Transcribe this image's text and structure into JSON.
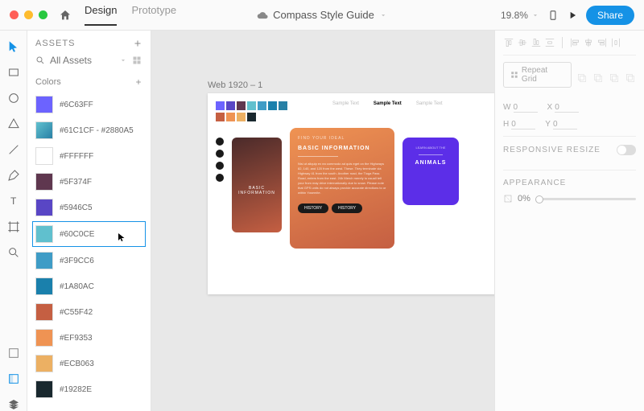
{
  "titlebar": {
    "tabs": {
      "design": "Design",
      "prototype": "Prototype"
    },
    "doc_name": "Compass Style Guide",
    "zoom": "19.8%",
    "share": "Share"
  },
  "assets": {
    "header": "ASSETS",
    "search_placeholder": "All Assets",
    "section_colors": "Colors",
    "colors": [
      {
        "hex": "#6C63FF",
        "label": "#6C63FF"
      },
      {
        "hex": "#1A80AC",
        "label": "#61C1CF - #2880A5",
        "gradient": "linear-gradient(135deg,#61C1CF,#2880A5)"
      },
      {
        "hex": "#FFFFFF",
        "label": "#FFFFFF"
      },
      {
        "hex": "#5F374F",
        "label": "#5F374F"
      },
      {
        "hex": "#5946C5",
        "label": "#5946C5"
      },
      {
        "hex": "#60C0CE",
        "label": "#60C0CE",
        "selected": true
      },
      {
        "hex": "#3F9CC6",
        "label": "#3F9CC6"
      },
      {
        "hex": "#1A80AC",
        "label": "#1A80AC"
      },
      {
        "hex": "#C55F42",
        "label": "#C55F42"
      },
      {
        "hex": "#EF9353",
        "label": "#EF9353"
      },
      {
        "hex": "#ECB063",
        "label": "#ECB063"
      },
      {
        "hex": "#19282E",
        "label": "#19282E"
      }
    ]
  },
  "canvas": {
    "artboard_label": "Web 1920 – 1",
    "palette_row1": [
      "#6C63FF",
      "#5946C5",
      "#5F374F",
      "#60C0CE",
      "#3F9CC6",
      "#1A80AC",
      "#2880A5"
    ],
    "palette_row2": [
      "#C55F42",
      "#EF9353",
      "#ECB063",
      "#19282E"
    ],
    "text_samples": [
      "Sample Text",
      "Sample Text",
      "Sample Text"
    ],
    "card1_label": "BASIC INFORMATION",
    "card2": {
      "eyebrow": "FIND YOUR IDEAL",
      "title": "BASIC INFORMATION",
      "body": "Nisi ut aliquip ex ea commodo ad quis eget on the Highways 82, 140, and 120 from the west. These. They terminate via Highway 41 from the south. Another road, the Tioga Pass Road, enters from the east. 24h Merch merely to usuall tell your from may drive internationally due to snow. Please note that GPS units do not always provide accurate directions to or within Yosemite.",
      "btn1": "HISTORY",
      "btn2": "HISTORY"
    },
    "card3": {
      "eyebrow": "LEARN ABOUT THE",
      "title": "ANIMALS"
    }
  },
  "inspector": {
    "repeat_grid": "Repeat Grid",
    "w_label": "W",
    "w_val": "0",
    "x_label": "X",
    "x_val": "0",
    "h_label": "H",
    "h_val": "0",
    "y_label": "Y",
    "y_val": "0",
    "responsive": "RESPONSIVE RESIZE",
    "appearance": "APPEARANCE",
    "opacity": "0%"
  }
}
